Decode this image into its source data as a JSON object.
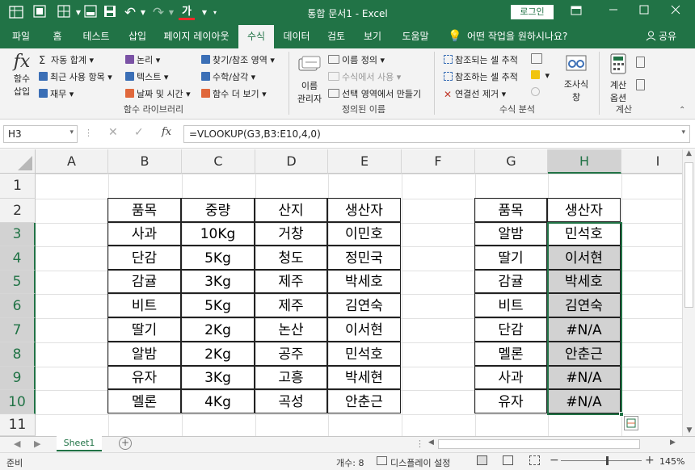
{
  "window": {
    "title": "통합 문서1  -  Excel",
    "login_label": "로그인"
  },
  "quick_access": {
    "font_color_glyph": "가"
  },
  "tabs": [
    {
      "label": "파일",
      "active": false
    },
    {
      "label": "홈",
      "active": false
    },
    {
      "label": "테스트",
      "active": false
    },
    {
      "label": "삽입",
      "active": false
    },
    {
      "label": "페이지 레이아웃",
      "active": false
    },
    {
      "label": "수식",
      "active": true
    },
    {
      "label": "데이터",
      "active": false
    },
    {
      "label": "검토",
      "active": false
    },
    {
      "label": "보기",
      "active": false
    },
    {
      "label": "도움말",
      "active": false
    }
  ],
  "tell_me": "어떤 작업을 원하시나요?",
  "share_label": "공유",
  "ribbon": {
    "insert_function": {
      "glyph": "fx",
      "line1": "함수",
      "line2": "삽입"
    },
    "library": [
      "자동 합계",
      "최근 사용 항목",
      "재무",
      "논리",
      "텍스트",
      "날짜 및 시간",
      "찾기/참조 영역",
      "수학/삼각",
      "함수 더 보기"
    ],
    "library_group": "함수 라이브러리",
    "name_manager": {
      "line1": "이름",
      "line2": "관리자"
    },
    "names": [
      "이름 정의",
      "수식에서 사용",
      "선택 영역에서 만들기"
    ],
    "names_group": "정의된 이름",
    "audit": [
      "참조되는 셀 추적",
      "참조하는 셀 추적",
      "연결선 제거"
    ],
    "watch": {
      "line1": "조사식",
      "line2": "창"
    },
    "audit_group": "수식 분석",
    "calc_options": {
      "line1": "계산",
      "line2": "옵션"
    },
    "calc_group": "계산"
  },
  "formula_bar": {
    "name_box": "H3",
    "fx": "fx",
    "formula": "=VLOOKUP(G3,B3:E10,4,0)"
  },
  "columns": [
    "A",
    "B",
    "C",
    "D",
    "E",
    "F",
    "G",
    "H",
    "I"
  ],
  "rows": [
    "1",
    "2",
    "3",
    "4",
    "5",
    "6",
    "7",
    "8",
    "9",
    "10",
    "11"
  ],
  "table1": {
    "headers": [
      "품목",
      "중량",
      "산지",
      "생산자"
    ],
    "rows": [
      [
        "사과",
        "10Kg",
        "거창",
        "이민호"
      ],
      [
        "단감",
        "5Kg",
        "청도",
        "정민국"
      ],
      [
        "감귤",
        "3Kg",
        "제주",
        "박세호"
      ],
      [
        "비트",
        "5Kg",
        "제주",
        "김연숙"
      ],
      [
        "딸기",
        "2Kg",
        "논산",
        "이서현"
      ],
      [
        "알밤",
        "2Kg",
        "공주",
        "민석호"
      ],
      [
        "유자",
        "3Kg",
        "고흥",
        "박세현"
      ],
      [
        "멜론",
        "4Kg",
        "곡성",
        "안춘근"
      ]
    ]
  },
  "table2": {
    "headers": [
      "품목",
      "생산자"
    ],
    "rows": [
      [
        "알밤",
        "민석호"
      ],
      [
        "딸기",
        "이서현"
      ],
      [
        "감귤",
        "박세호"
      ],
      [
        "비트",
        "김연숙"
      ],
      [
        "단감",
        "#N/A"
      ],
      [
        "멜론",
        "안춘근"
      ],
      [
        "사과",
        "#N/A"
      ],
      [
        "유자",
        "#N/A"
      ]
    ]
  },
  "sheet_tab": "Sheet1",
  "status": {
    "mode": "준비",
    "count": "개수: 8",
    "display_settings": "디스플레이 설정",
    "zoom": "145%"
  },
  "colors": {
    "accent": "#217346",
    "selection": "#d2d2d2",
    "error_marker": "#2e7d32"
  }
}
